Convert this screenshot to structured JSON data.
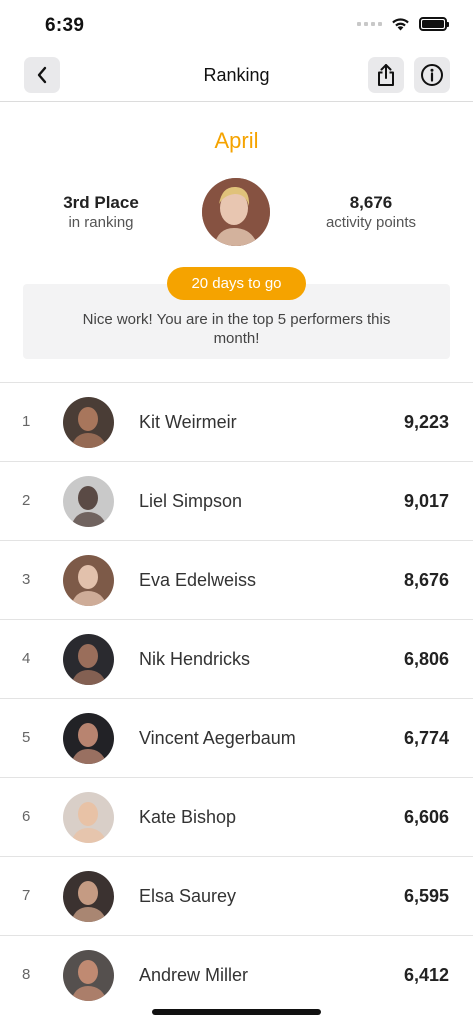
{
  "status": {
    "time": "6:39"
  },
  "nav": {
    "title": "Ranking"
  },
  "hero": {
    "month": "April",
    "place": "3rd Place",
    "place_label": "in ranking",
    "points": "8,676",
    "points_label": "activity points",
    "days_to_go": "20 days to go",
    "message": "Nice work! You are in the top 5 performers this month!"
  },
  "ranking": [
    {
      "rank": "1",
      "name": "Kit Weirmeir",
      "points": "9,223",
      "avatar_bg": "#4a3d36",
      "avatar_fg": "#a8765c"
    },
    {
      "rank": "2",
      "name": "Liel Simpson",
      "points": "9,017",
      "avatar_bg": "#c9c9c9",
      "avatar_fg": "#5a4a45"
    },
    {
      "rank": "3",
      "name": "Eva Edelweiss",
      "points": "8,676",
      "avatar_bg": "#7d5a48",
      "avatar_fg": "#e2c1ac"
    },
    {
      "rank": "4",
      "name": "Nik Hendricks",
      "points": "6,806",
      "avatar_bg": "#2a2a2f",
      "avatar_fg": "#9a6e5b"
    },
    {
      "rank": "5",
      "name": "Vincent Aegerbaum",
      "points": "6,774",
      "avatar_bg": "#222226",
      "avatar_fg": "#b88470"
    },
    {
      "rank": "6",
      "name": "Kate Bishop",
      "points": "6,606",
      "avatar_bg": "#d9cfc8",
      "avatar_fg": "#e8c2a6"
    },
    {
      "rank": "7",
      "name": "Elsa Saurey",
      "points": "6,595",
      "avatar_bg": "#3b3230",
      "avatar_fg": "#c59b83"
    },
    {
      "rank": "8",
      "name": "Andrew Miller",
      "points": "6,412",
      "avatar_bg": "#55504e",
      "avatar_fg": "#c08a72"
    }
  ],
  "colors": {
    "accent": "#f5a300",
    "box_bg": "#f3f3f4",
    "button_bg": "#e9e9eb"
  },
  "icons": {
    "back": "chevron-left-icon",
    "share": "share-icon",
    "info": "info-icon"
  }
}
